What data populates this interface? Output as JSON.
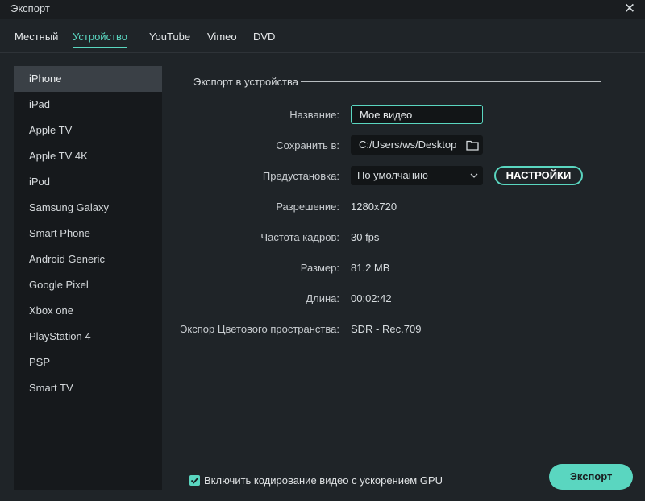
{
  "window": {
    "title": "Экспорт"
  },
  "tabs": [
    {
      "label": "Местный"
    },
    {
      "label": "Устройство",
      "active": true
    },
    {
      "label": "YouTube"
    },
    {
      "label": "Vimeo"
    },
    {
      "label": "DVD"
    }
  ],
  "sidebar": {
    "items": [
      {
        "label": "iPhone",
        "selected": true
      },
      {
        "label": "iPad"
      },
      {
        "label": "Apple TV"
      },
      {
        "label": "Apple TV 4K"
      },
      {
        "label": "iPod"
      },
      {
        "label": "Samsung Galaxy"
      },
      {
        "label": "Smart Phone"
      },
      {
        "label": "Android Generic"
      },
      {
        "label": "Google Pixel"
      },
      {
        "label": "Xbox one"
      },
      {
        "label": "PlayStation 4"
      },
      {
        "label": "PSP"
      },
      {
        "label": "Smart TV"
      }
    ]
  },
  "form": {
    "section_title": "Экспорт в устройства",
    "name_label": "Название:",
    "name_value": "Мое видео",
    "save_label": "Сохранить в:",
    "save_path": "C:/Users/ws/Desktop",
    "preset_label": "Предустановка:",
    "preset_value": "По умолчанию",
    "settings_button": "НАСТРОЙКИ",
    "resolution_label": "Разрешение:",
    "resolution_value": "1280x720",
    "framerate_label": "Частота кадров:",
    "framerate_value": "30 fps",
    "size_label": "Размер:",
    "size_value": "81.2 MB",
    "duration_label": "Длина:",
    "duration_value": "00:02:42",
    "colorspace_label": "Экспор Цветового пространства:",
    "colorspace_value": "SDR - Rec.709"
  },
  "footer": {
    "gpu_label": "Включить кодирование видео с ускорением GPU",
    "gpu_checked": true,
    "export_button": "Экспорт"
  },
  "colors": {
    "accent": "#5ad6c0",
    "background": "#1f2428",
    "sidebar": "#16191c"
  },
  "icons": {
    "close": "close-icon",
    "folder": "folder-icon",
    "dropdown": "chevron-down-icon",
    "check": "check-icon"
  }
}
